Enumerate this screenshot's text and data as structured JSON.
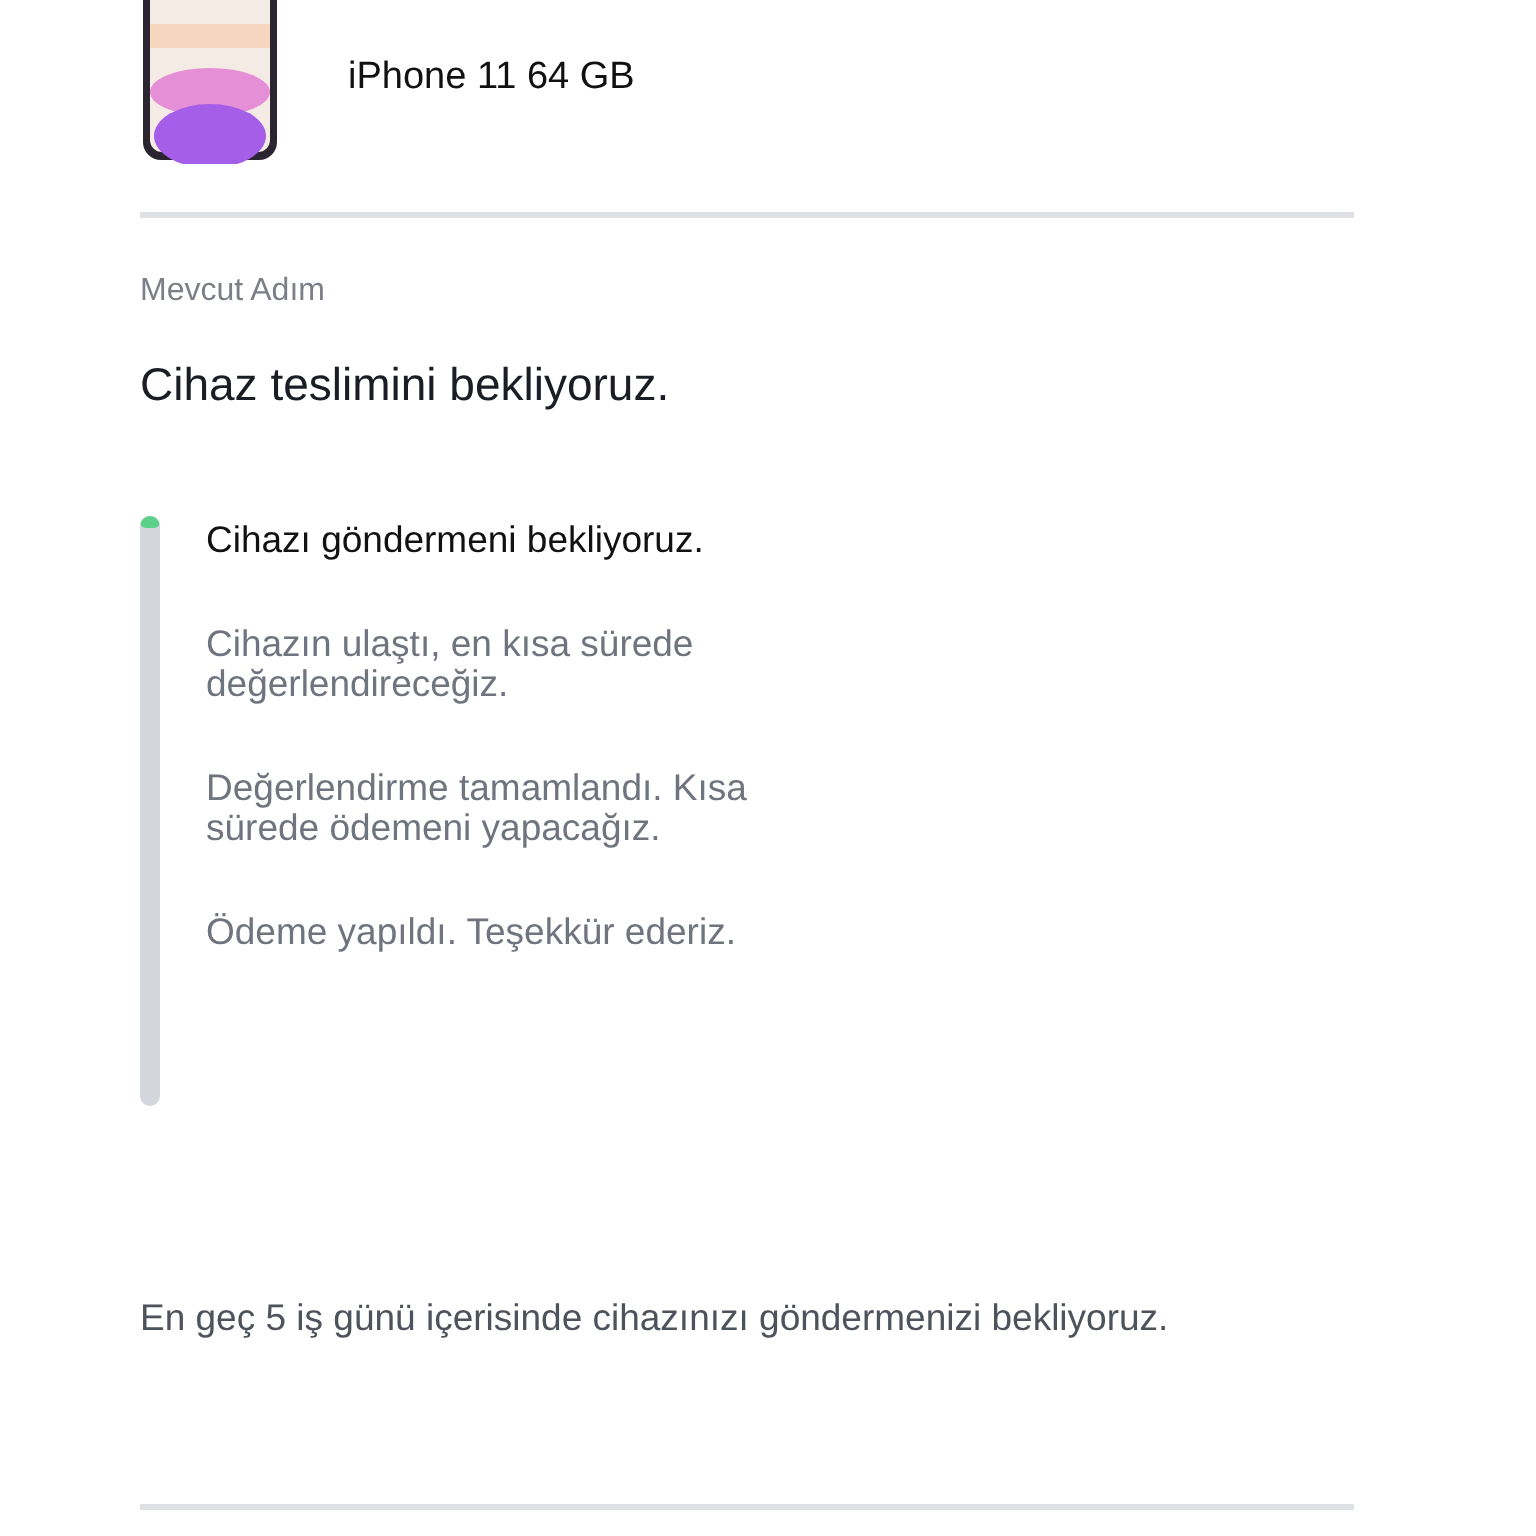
{
  "product": {
    "name": "iPhone 11 64 GB"
  },
  "current_step": {
    "label": "Mevcut Adım",
    "title": "Cihaz teslimini bekliyoruz."
  },
  "progress": {
    "level": 0.02
  },
  "steps": [
    {
      "text": "Cihazı göndermeni bekliyoruz.",
      "selected": true
    },
    {
      "text": "Cihazın ulaştı, en kısa sürede değerlendireceğiz.",
      "selected": false
    },
    {
      "text": "Değerlendirme tamamlandı. Kısa sürede ödemeni yapacağız.",
      "selected": false
    },
    {
      "text": "Ödeme yapıldı. Teşekkür ederiz.",
      "selected": false
    }
  ],
  "note": "En geç 5 iş günü içerisinde cihazınızı göndermenizi bekliyoruz."
}
